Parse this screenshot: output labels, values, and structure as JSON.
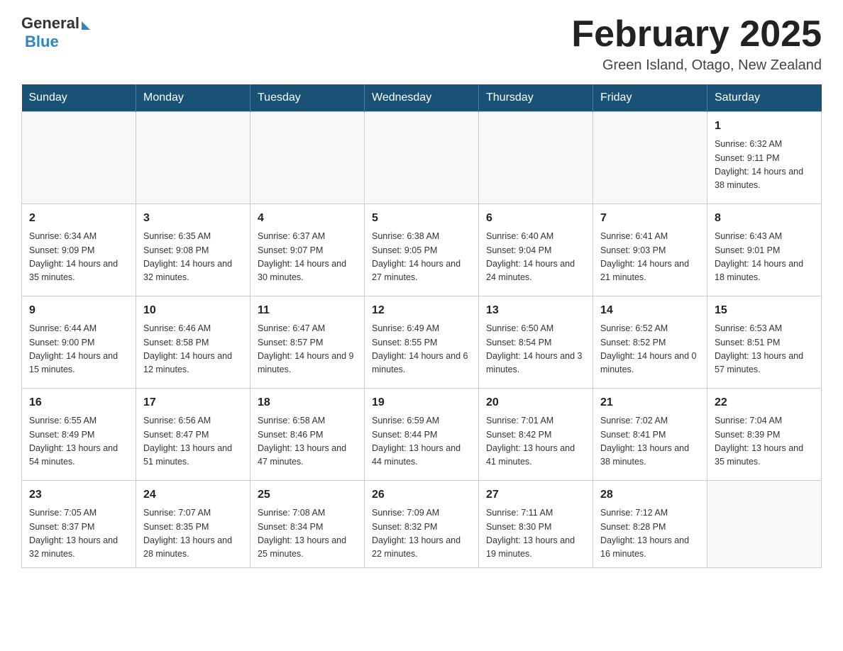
{
  "logo": {
    "general": "General",
    "blue": "Blue"
  },
  "title": "February 2025",
  "location": "Green Island, Otago, New Zealand",
  "days_of_week": [
    "Sunday",
    "Monday",
    "Tuesday",
    "Wednesday",
    "Thursday",
    "Friday",
    "Saturday"
  ],
  "weeks": [
    [
      {
        "day": "",
        "info": ""
      },
      {
        "day": "",
        "info": ""
      },
      {
        "day": "",
        "info": ""
      },
      {
        "day": "",
        "info": ""
      },
      {
        "day": "",
        "info": ""
      },
      {
        "day": "",
        "info": ""
      },
      {
        "day": "1",
        "info": "Sunrise: 6:32 AM\nSunset: 9:11 PM\nDaylight: 14 hours and 38 minutes."
      }
    ],
    [
      {
        "day": "2",
        "info": "Sunrise: 6:34 AM\nSunset: 9:09 PM\nDaylight: 14 hours and 35 minutes."
      },
      {
        "day": "3",
        "info": "Sunrise: 6:35 AM\nSunset: 9:08 PM\nDaylight: 14 hours and 32 minutes."
      },
      {
        "day": "4",
        "info": "Sunrise: 6:37 AM\nSunset: 9:07 PM\nDaylight: 14 hours and 30 minutes."
      },
      {
        "day": "5",
        "info": "Sunrise: 6:38 AM\nSunset: 9:05 PM\nDaylight: 14 hours and 27 minutes."
      },
      {
        "day": "6",
        "info": "Sunrise: 6:40 AM\nSunset: 9:04 PM\nDaylight: 14 hours and 24 minutes."
      },
      {
        "day": "7",
        "info": "Sunrise: 6:41 AM\nSunset: 9:03 PM\nDaylight: 14 hours and 21 minutes."
      },
      {
        "day": "8",
        "info": "Sunrise: 6:43 AM\nSunset: 9:01 PM\nDaylight: 14 hours and 18 minutes."
      }
    ],
    [
      {
        "day": "9",
        "info": "Sunrise: 6:44 AM\nSunset: 9:00 PM\nDaylight: 14 hours and 15 minutes."
      },
      {
        "day": "10",
        "info": "Sunrise: 6:46 AM\nSunset: 8:58 PM\nDaylight: 14 hours and 12 minutes."
      },
      {
        "day": "11",
        "info": "Sunrise: 6:47 AM\nSunset: 8:57 PM\nDaylight: 14 hours and 9 minutes."
      },
      {
        "day": "12",
        "info": "Sunrise: 6:49 AM\nSunset: 8:55 PM\nDaylight: 14 hours and 6 minutes."
      },
      {
        "day": "13",
        "info": "Sunrise: 6:50 AM\nSunset: 8:54 PM\nDaylight: 14 hours and 3 minutes."
      },
      {
        "day": "14",
        "info": "Sunrise: 6:52 AM\nSunset: 8:52 PM\nDaylight: 14 hours and 0 minutes."
      },
      {
        "day": "15",
        "info": "Sunrise: 6:53 AM\nSunset: 8:51 PM\nDaylight: 13 hours and 57 minutes."
      }
    ],
    [
      {
        "day": "16",
        "info": "Sunrise: 6:55 AM\nSunset: 8:49 PM\nDaylight: 13 hours and 54 minutes."
      },
      {
        "day": "17",
        "info": "Sunrise: 6:56 AM\nSunset: 8:47 PM\nDaylight: 13 hours and 51 minutes."
      },
      {
        "day": "18",
        "info": "Sunrise: 6:58 AM\nSunset: 8:46 PM\nDaylight: 13 hours and 47 minutes."
      },
      {
        "day": "19",
        "info": "Sunrise: 6:59 AM\nSunset: 8:44 PM\nDaylight: 13 hours and 44 minutes."
      },
      {
        "day": "20",
        "info": "Sunrise: 7:01 AM\nSunset: 8:42 PM\nDaylight: 13 hours and 41 minutes."
      },
      {
        "day": "21",
        "info": "Sunrise: 7:02 AM\nSunset: 8:41 PM\nDaylight: 13 hours and 38 minutes."
      },
      {
        "day": "22",
        "info": "Sunrise: 7:04 AM\nSunset: 8:39 PM\nDaylight: 13 hours and 35 minutes."
      }
    ],
    [
      {
        "day": "23",
        "info": "Sunrise: 7:05 AM\nSunset: 8:37 PM\nDaylight: 13 hours and 32 minutes."
      },
      {
        "day": "24",
        "info": "Sunrise: 7:07 AM\nSunset: 8:35 PM\nDaylight: 13 hours and 28 minutes."
      },
      {
        "day": "25",
        "info": "Sunrise: 7:08 AM\nSunset: 8:34 PM\nDaylight: 13 hours and 25 minutes."
      },
      {
        "day": "26",
        "info": "Sunrise: 7:09 AM\nSunset: 8:32 PM\nDaylight: 13 hours and 22 minutes."
      },
      {
        "day": "27",
        "info": "Sunrise: 7:11 AM\nSunset: 8:30 PM\nDaylight: 13 hours and 19 minutes."
      },
      {
        "day": "28",
        "info": "Sunrise: 7:12 AM\nSunset: 8:28 PM\nDaylight: 13 hours and 16 minutes."
      },
      {
        "day": "",
        "info": ""
      }
    ]
  ]
}
